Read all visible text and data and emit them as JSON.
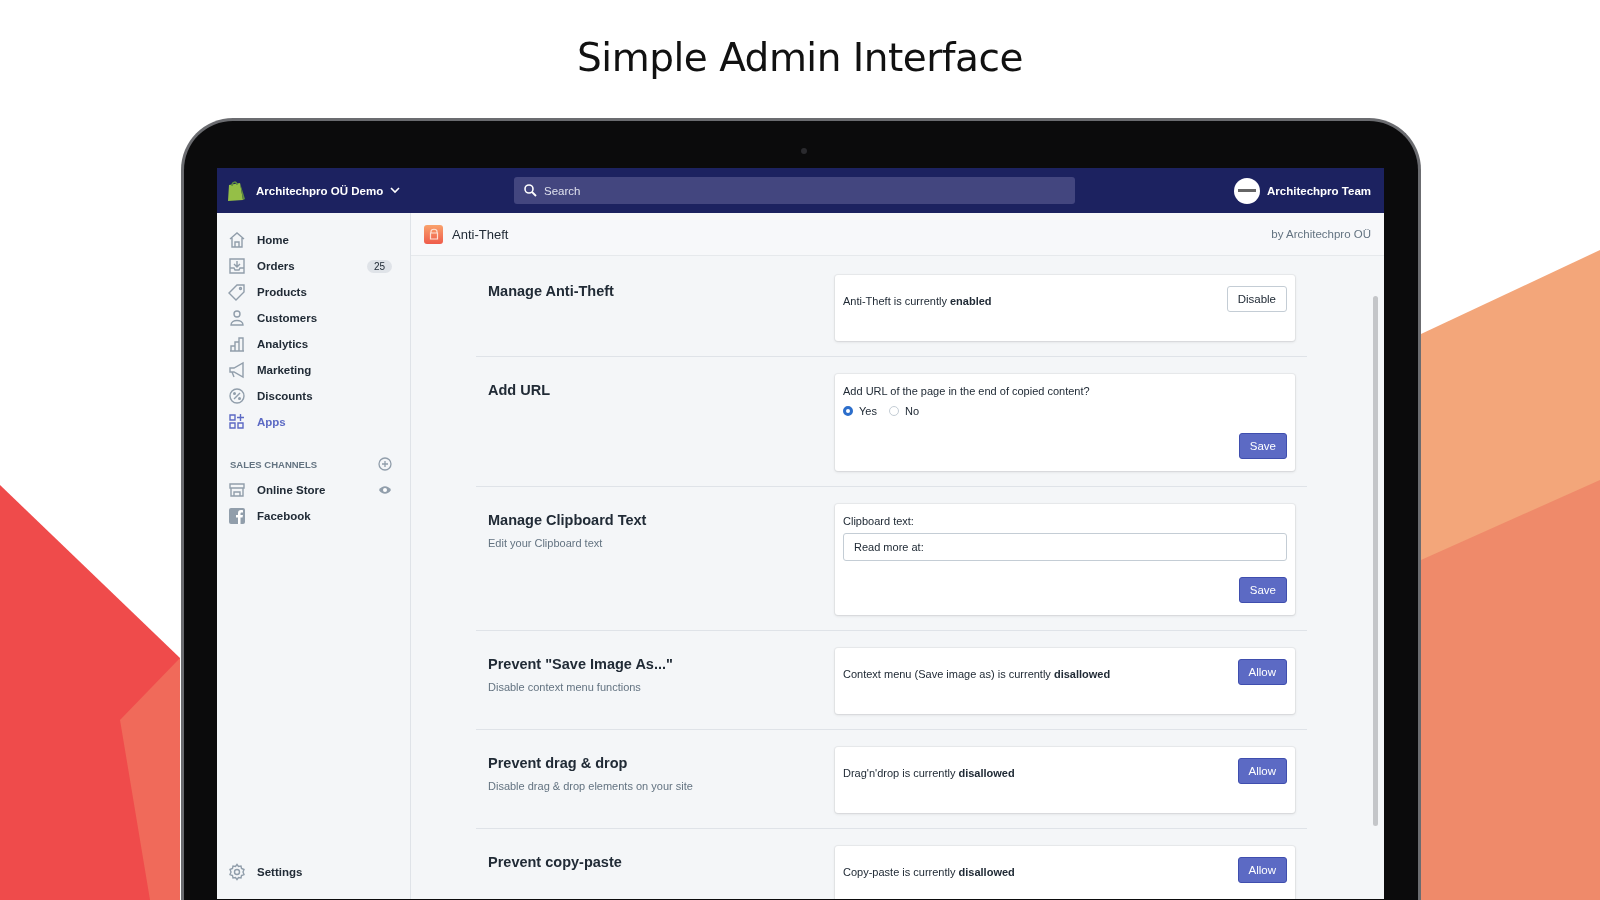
{
  "heading": "Simple Admin Interface",
  "topbar": {
    "store": "Architechpro OÜ Demo",
    "search": {
      "placeholder": "Search"
    },
    "account": "Architechpro Team"
  },
  "sidebar": {
    "items": [
      {
        "label": "Home",
        "selected": false
      },
      {
        "label": "Orders",
        "selected": false,
        "badge": "25"
      },
      {
        "label": "Products",
        "selected": false
      },
      {
        "label": "Customers",
        "selected": false
      },
      {
        "label": "Analytics",
        "selected": false
      },
      {
        "label": "Marketing",
        "selected": false
      },
      {
        "label": "Discounts",
        "selected": false
      },
      {
        "label": "Apps",
        "selected": true
      }
    ],
    "channels_heading": "SALES CHANNELS",
    "channels": [
      {
        "label": "Online Store"
      },
      {
        "label": "Facebook"
      }
    ],
    "settings": "Settings"
  },
  "app_header": {
    "title": "Anti-Theft",
    "vendor": "by Architechpro OÜ"
  },
  "sections": [
    {
      "title": "Manage Anti-Theft",
      "card": {
        "kind": "status",
        "text": "Anti-Theft is currently **enabled**",
        "button": {
          "label": "Disable",
          "primary": false
        }
      }
    },
    {
      "title": "Add URL",
      "card": {
        "kind": "radio",
        "question": "Add URL of the page in the end of copied content?",
        "options": [
          {
            "label": "Yes",
            "selected": true
          },
          {
            "label": "No",
            "selected": false
          }
        ],
        "button": {
          "label": "Save",
          "primary": true
        }
      }
    },
    {
      "title": "Manage Clipboard Text",
      "subtitle": "Edit your Clipboard text",
      "card": {
        "kind": "field",
        "label": "Clipboard text:",
        "value": "Read more at:",
        "button": {
          "label": "Save",
          "primary": true
        }
      }
    },
    {
      "title": "Prevent \"Save Image As...\"",
      "subtitle": "Disable context menu functions",
      "card": {
        "kind": "status",
        "text": "Context menu (Save image as) is currently **disallowed**",
        "button": {
          "label": "Allow",
          "primary": true
        }
      }
    },
    {
      "title": "Prevent drag & drop",
      "subtitle": "Disable drag & drop elements on your site",
      "card": {
        "kind": "status",
        "text": "Drag'n'drop is currently **disallowed**",
        "button": {
          "label": "Allow",
          "primary": true
        }
      }
    },
    {
      "title": "Prevent copy-paste",
      "card": {
        "kind": "status",
        "text": "Copy-paste is currently **disallowed**",
        "button": {
          "label": "Allow",
          "primary": true
        }
      }
    }
  ]
}
